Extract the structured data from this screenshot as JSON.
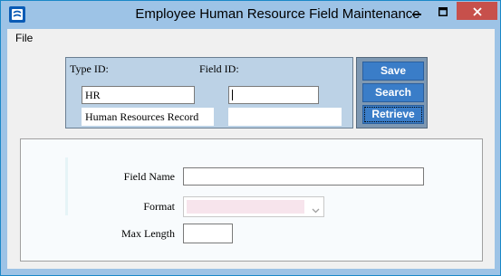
{
  "window": {
    "title": "Employee Human Resource Field Maintenance"
  },
  "menu": {
    "file_label": "File"
  },
  "id_panel": {
    "type_id_label": "Type ID:",
    "field_id_label": "Field ID:",
    "type_id_value": "HR",
    "field_id_value": "",
    "type_description": "Human Resources Record",
    "field_description": ""
  },
  "buttons": {
    "save_label": "Save",
    "search_label": "Search",
    "retrieve_label": "Retrieve"
  },
  "form": {
    "field_name_label": "Field Name",
    "field_name_value": "",
    "format_label": "Format",
    "format_value": "",
    "max_length_label": "Max Length",
    "max_length_value": ""
  },
  "icons": {
    "app": "app-icon",
    "minimize": "minimize-icon",
    "maximize": "maximize-icon",
    "close": "close-icon",
    "dropdown": "chevron-down-icon"
  },
  "colors": {
    "title_bar": "#9dc3e6",
    "button": "#3a7dc8",
    "close_button": "#c7504b"
  }
}
